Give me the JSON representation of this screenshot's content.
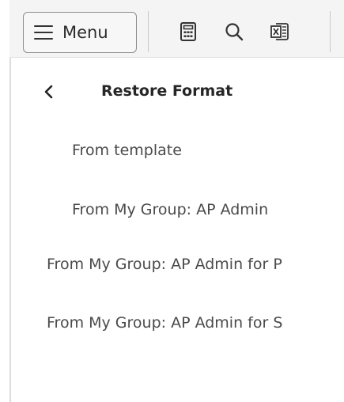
{
  "toolbar": {
    "menu_label": "Menu",
    "icons": [
      "calculator-icon",
      "search-icon",
      "excel-export-icon"
    ]
  },
  "panel": {
    "back_icon": "chevron-left-icon",
    "title": "Restore Format",
    "items": [
      {
        "label": "From template"
      },
      {
        "label": "From My Group: AP Admin"
      },
      {
        "label": "From My Group: AP Admin for P"
      },
      {
        "label": "From My Group: AP Admin for S"
      }
    ]
  },
  "colors": {
    "toolbar_bg": "#f4f4f4",
    "text": "#4a4a4a",
    "title": "#262626",
    "border": "#8c8c8c"
  }
}
